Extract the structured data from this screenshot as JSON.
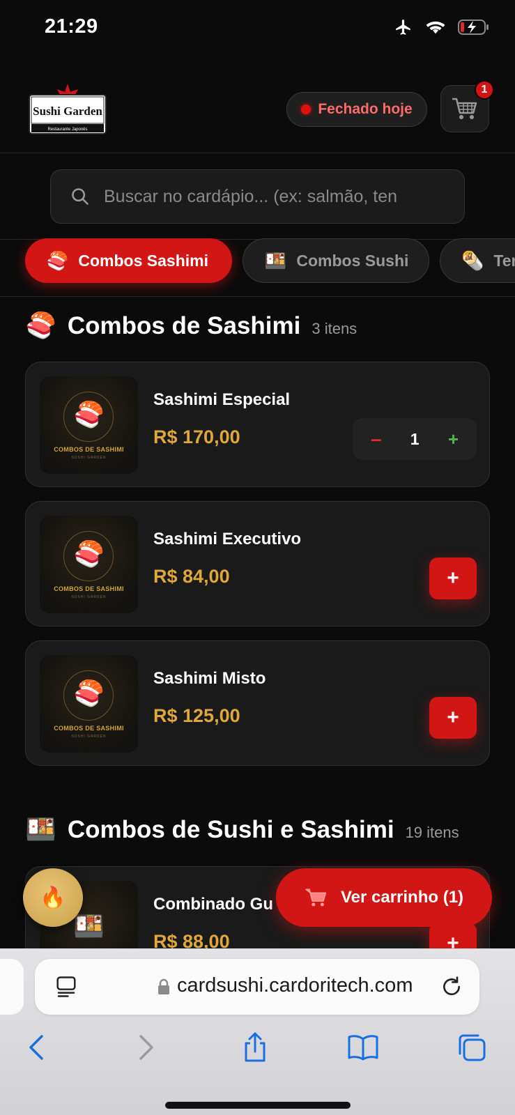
{
  "status_bar": {
    "time": "21:29"
  },
  "header": {
    "logo": {
      "name": "Sushi Garden",
      "subtitle": "Restaurante Japonês"
    },
    "status_label": "Fechado hoje",
    "cart_count": "1"
  },
  "search": {
    "placeholder": "Buscar no cardápio... (ex: salmão, ten"
  },
  "tabs": [
    {
      "emoji": "🍣",
      "label": "Combos Sashimi",
      "active": true
    },
    {
      "emoji": "🍱",
      "label": "Combos Sushi",
      "active": false
    },
    {
      "emoji": "🌯",
      "label": "Ter",
      "active": false
    }
  ],
  "sections": [
    {
      "emoji": "🍣",
      "title": "Combos de Sashimi",
      "count": "3 itens",
      "products": [
        {
          "name": "Sashimi Especial",
          "price": "R$ 170,00",
          "quantity": "1",
          "image_caption": "COMBOS DE SASHIMI",
          "image_sub": "SUSHI GARDEN"
        },
        {
          "name": "Sashimi Executivo",
          "price": "R$ 84,00",
          "image_caption": "COMBOS DE SASHIMI",
          "image_sub": "SUSHI GARDEN"
        },
        {
          "name": "Sashimi Misto",
          "price": "R$ 125,00",
          "image_caption": "COMBOS DE SASHIMI",
          "image_sub": "SUSHI GARDEN"
        }
      ]
    },
    {
      "emoji": "🍱",
      "title": "Combos de Sushi e Sashimi",
      "count": "19 itens",
      "products": [
        {
          "name": "Combinado Gu",
          "price": "R$ 88,00"
        }
      ]
    }
  ],
  "floating": {
    "fire_emoji": "🔥",
    "view_cart_label": "Ver carrinho (1)"
  },
  "browser": {
    "url": "cardsushi.cardoritech.com"
  },
  "colors": {
    "accent_red": "#d21616",
    "price_gold": "#e0a83a",
    "background": "#0b0b0b"
  }
}
